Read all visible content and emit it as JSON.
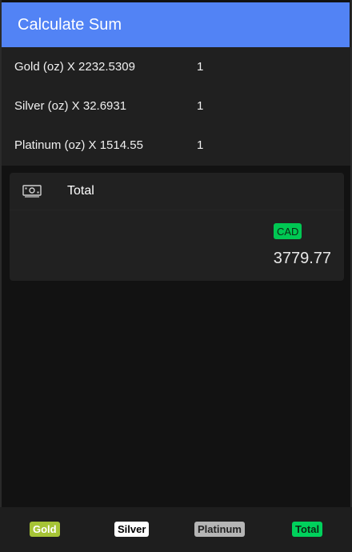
{
  "header": {
    "title": "Calculate Sum"
  },
  "metals": [
    {
      "label": "Gold (oz) X 2232.5309",
      "quantity": "1"
    },
    {
      "label": "Silver (oz) X 32.6931",
      "quantity": "1"
    },
    {
      "label": "Platinum (oz) X 1514.55",
      "quantity": "1"
    }
  ],
  "total_card": {
    "icon": "cash-icon",
    "label": "Total",
    "currency": "CAD",
    "value": "3779.77"
  },
  "bottom_nav": {
    "items": [
      {
        "label": "Gold",
        "color": "#a6c436"
      },
      {
        "label": "Silver",
        "color": "#ffffff"
      },
      {
        "label": "Platinum",
        "color": "#b5b5b5"
      },
      {
        "label": "Total",
        "color": "#00d15c"
      }
    ]
  },
  "colors": {
    "header": "#5283f5",
    "background": "#121212",
    "accent_green": "#00c853"
  }
}
